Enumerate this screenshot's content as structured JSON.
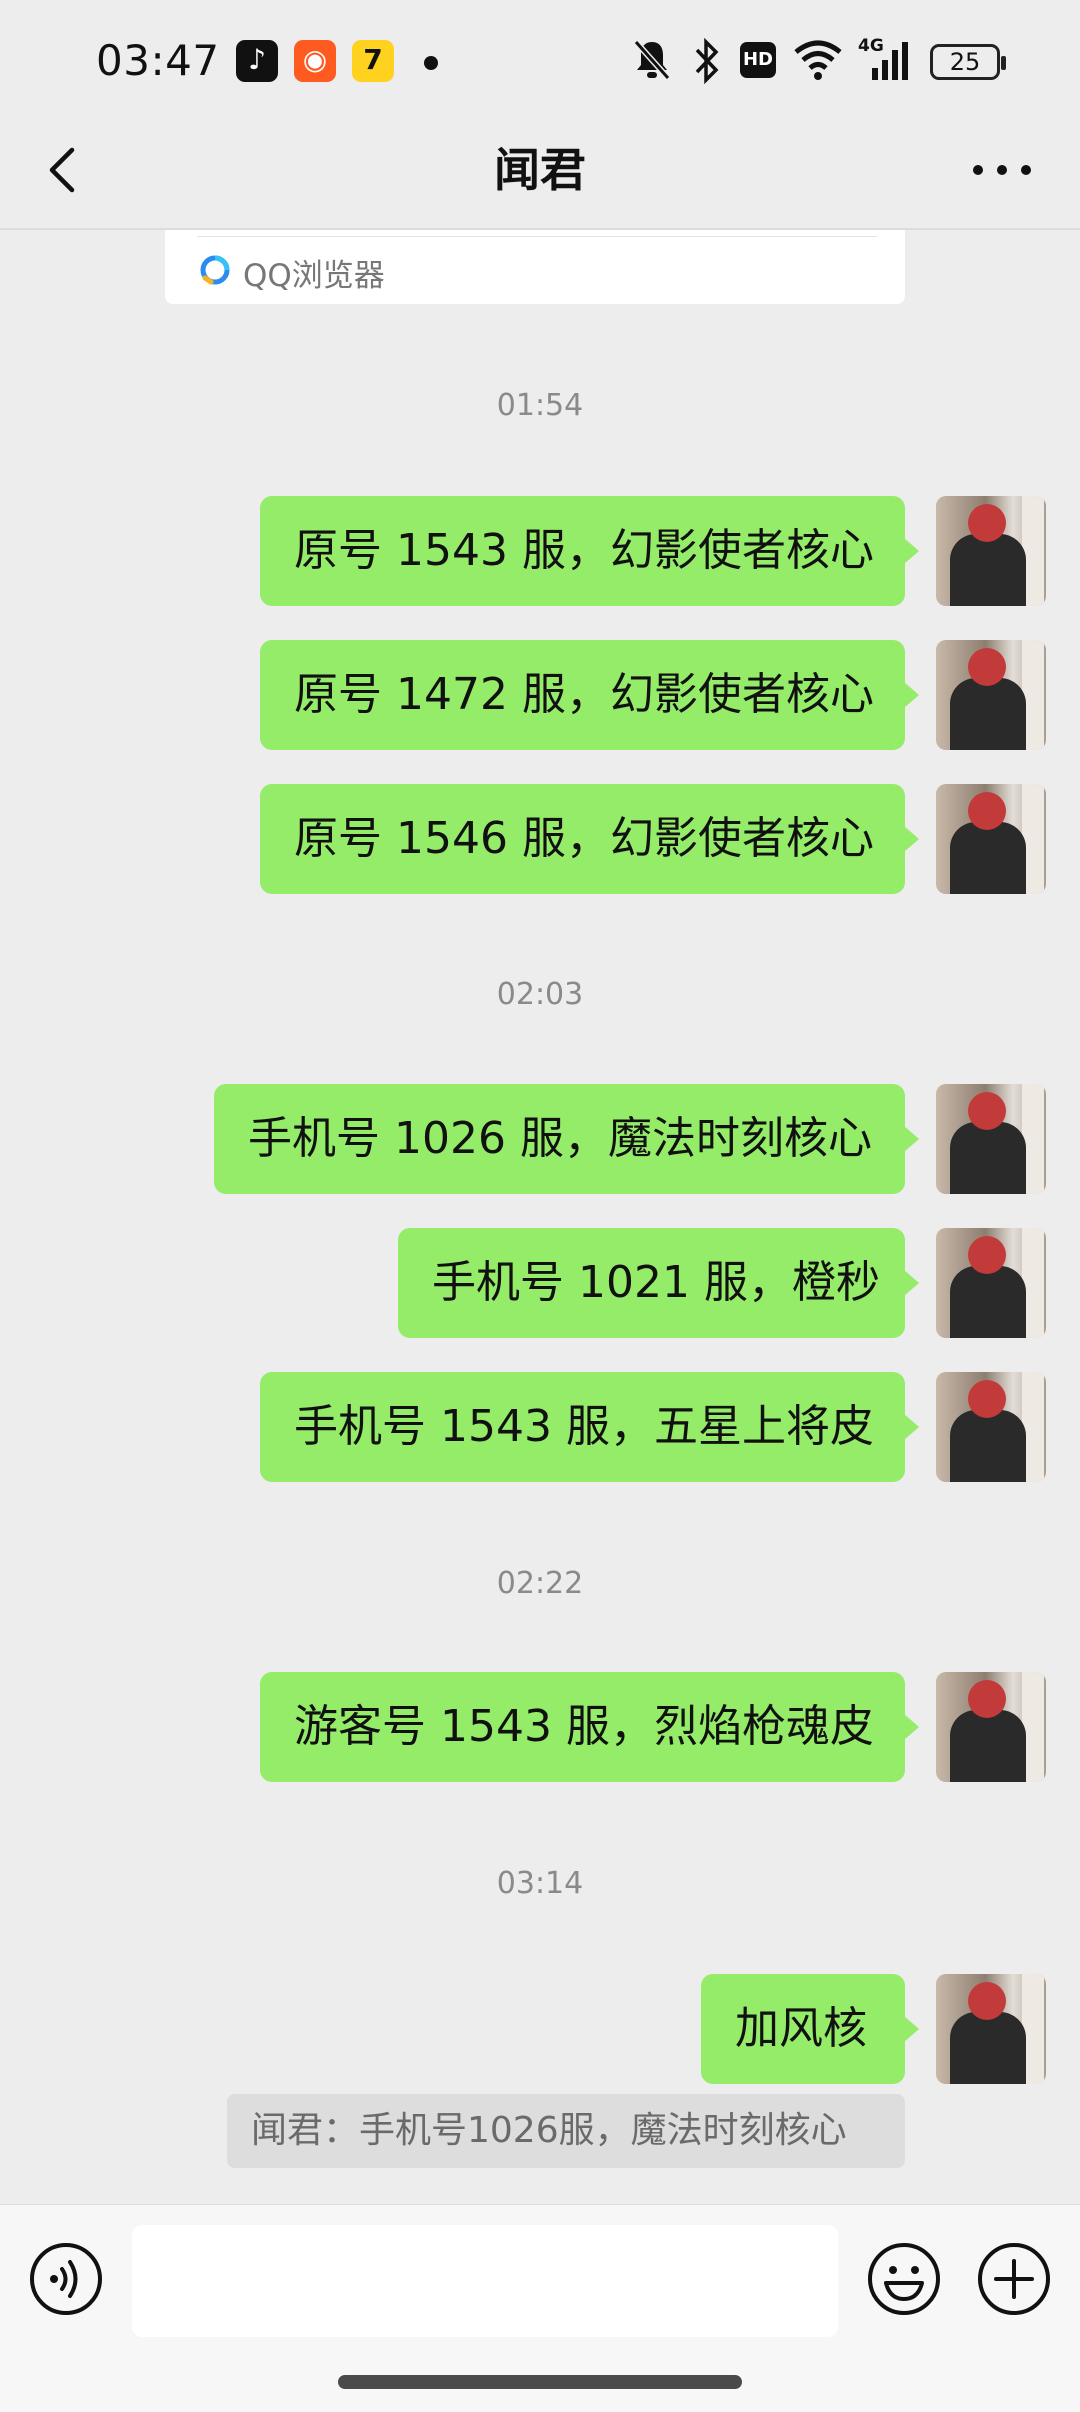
{
  "status_bar": {
    "time": "03:47",
    "battery": "25",
    "apps": [
      "tiktok-icon",
      "kuaishou-icon",
      "qimao-icon"
    ],
    "indicators": [
      "mute-icon",
      "bluetooth-icon",
      "hd-icon",
      "wifi-icon",
      "4g-signal-icon",
      "battery-icon"
    ],
    "hd_label": "HD",
    "net_label": "4G"
  },
  "header": {
    "title": "闻君",
    "back_icon": "chevron-left-icon",
    "more_icon": "more-dots-icon"
  },
  "link_card": {
    "source": "QQ浏览器"
  },
  "messages": {
    "ts1": "01:54",
    "m1": "原号 1543 服，幻影使者核心",
    "m2": "原号 1472 服，幻影使者核心",
    "m3": "原号 1546 服，幻影使者核心",
    "ts2": "02:03",
    "m4": "手机号 1026 服，魔法时刻核心",
    "m5": "手机号 1021 服，橙秒",
    "m6": "手机号 1543 服，五星上将皮",
    "ts3": "02:22",
    "m7": "游客号 1543 服，烈焰枪魂皮",
    "ts4": "03:14",
    "m8": "加风核",
    "quote": "闻君：手机号1026服，魔法时刻核心"
  },
  "input_bar": {
    "voice_icon": "voice-icon",
    "emoji_icon": "emoji-icon",
    "plus_icon": "plus-icon",
    "input_value": ""
  },
  "colors": {
    "background": "#ededed",
    "bubble": "#95ec69",
    "timestamp": "#8a8a8a"
  }
}
